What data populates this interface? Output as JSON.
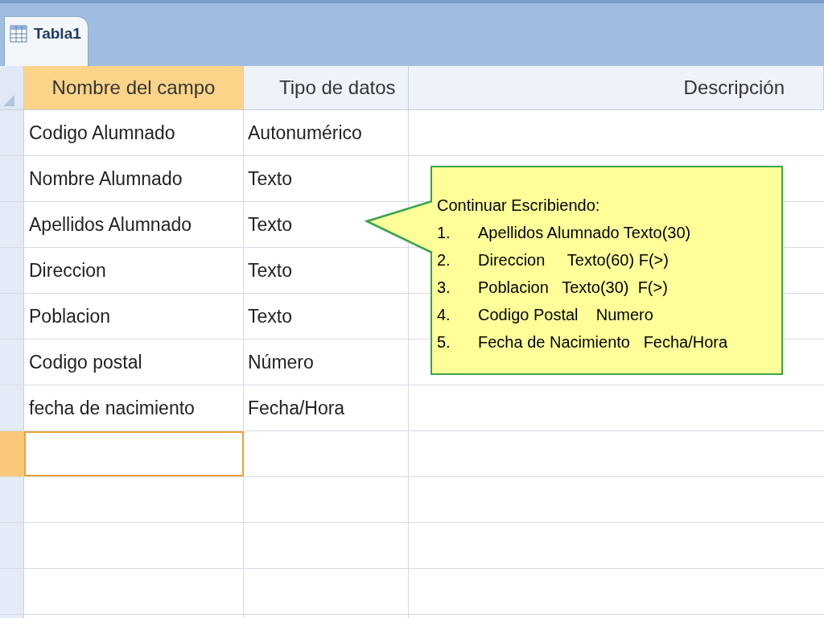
{
  "tab": {
    "label": "Tabla1",
    "selected": true
  },
  "columns": [
    {
      "label": "Nombre del campo",
      "selected": true
    },
    {
      "label": "Tipo de datos",
      "selected": false
    },
    {
      "label": "Descripción",
      "selected": false
    }
  ],
  "rows": [
    {
      "field": "Codigo Alumnado",
      "type": "Autonumérico"
    },
    {
      "field": "Nombre Alumnado",
      "type": "Texto"
    },
    {
      "field": "Apellidos Alumnado",
      "type": "Texto"
    },
    {
      "field": "Direccion",
      "type": "Texto"
    },
    {
      "field": "Poblacion",
      "type": "Texto"
    },
    {
      "field": "Codigo postal",
      "type": "Número"
    },
    {
      "field": "fecha de nacimiento",
      "type": "Fecha/Hora"
    }
  ],
  "new_row": {
    "selected": true
  },
  "callout": {
    "title": "Continuar Escribiendo:",
    "items": [
      {
        "number": "1.",
        "text": "Apellidos Alumnado Texto(30)"
      },
      {
        "number": "2.",
        "text": "Direccion     Texto(60) F(>)"
      },
      {
        "number": "3.",
        "text": "Poblacion   Texto(30)  F(>)"
      },
      {
        "number": "4.",
        "text": "Codigo Postal    Numero"
      },
      {
        "number": "5.",
        "text": "Fecha de Nacimiento   Fecha/Hora"
      }
    ]
  }
}
